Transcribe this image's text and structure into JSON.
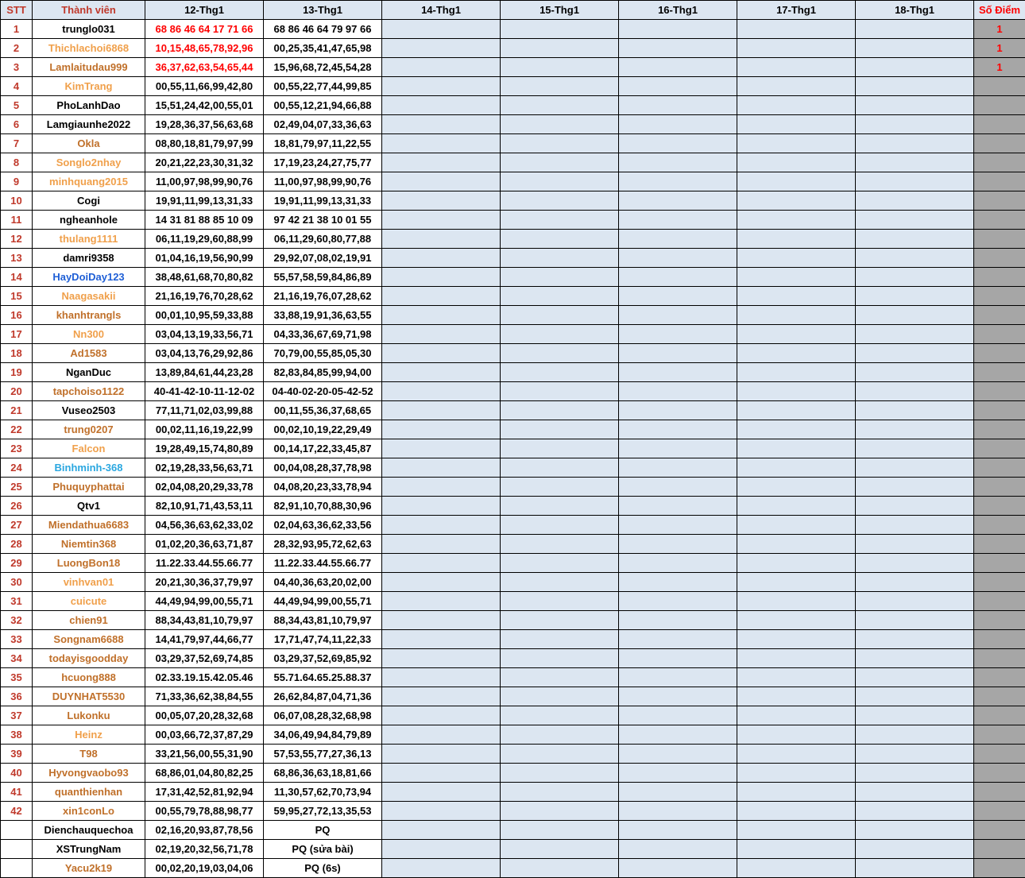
{
  "header": {
    "stt": "STT",
    "member": "Thành viên",
    "days": [
      "12-Thg1",
      "13-Thg1",
      "14-Thg1",
      "15-Thg1",
      "16-Thg1",
      "17-Thg1",
      "18-Thg1"
    ],
    "score": "Số Điểm"
  },
  "colors": {
    "black": "#000000",
    "orange": "#f0a04b",
    "brown": "#c0702a",
    "red": "#ff0000",
    "blue": "#1f5fd6",
    "cyan": "#2aa7e0",
    "header_bg": "#dce6f1",
    "score_bg": "#a6a6a6"
  },
  "rows": [
    {
      "stt": "1",
      "name": "trunglo031",
      "nameColor": "black",
      "d12": "68 86 46 64 17 71 66",
      "d12Red": true,
      "d13": "68 86 46 64 79 97 66",
      "score": "1"
    },
    {
      "stt": "2",
      "name": "Thichlachoi6868",
      "nameColor": "orange",
      "d12": "10,15,48,65,78,92,96",
      "d12Red": true,
      "d13": "00,25,35,41,47,65,98",
      "score": "1"
    },
    {
      "stt": "3",
      "name": "Lamlaitudau999",
      "nameColor": "brown",
      "d12": "36,37,62,63,54,65,44",
      "d12Red": true,
      "d13": "15,96,68,72,45,54,28",
      "score": "1"
    },
    {
      "stt": "4",
      "name": "KimTrang",
      "nameColor": "orange",
      "d12": "00,55,11,66,99,42,80",
      "d13": "00,55,22,77,44,99,85",
      "score": ""
    },
    {
      "stt": "5",
      "name": "PhoLanhDao",
      "nameColor": "black",
      "d12": "15,51,24,42,00,55,01",
      "d13": "00,55,12,21,94,66,88",
      "score": ""
    },
    {
      "stt": "6",
      "name": "Lamgiaunhe2022",
      "nameColor": "black",
      "d12": "19,28,36,37,56,63,68",
      "d13": "02,49,04,07,33,36,63",
      "score": ""
    },
    {
      "stt": "7",
      "name": "Okla",
      "nameColor": "brown",
      "d12": "08,80,18,81,79,97,99",
      "d13": "18,81,79,97,11,22,55",
      "score": ""
    },
    {
      "stt": "8",
      "name": "Songlo2nhay",
      "nameColor": "orange",
      "d12": "20,21,22,23,30,31,32",
      "d13": "17,19,23,24,27,75,77",
      "score": ""
    },
    {
      "stt": "9",
      "name": "minhquang2015",
      "nameColor": "orange",
      "d12": "11,00,97,98,99,90,76",
      "d13": "11,00,97,98,99,90,76",
      "score": ""
    },
    {
      "stt": "10",
      "name": "Cogi",
      "nameColor": "black",
      "d12": "19,91,11,99,13,31,33",
      "d13": "19,91,11,99,13,31,33",
      "score": ""
    },
    {
      "stt": "11",
      "name": "ngheanhole",
      "nameColor": "black",
      "d12": "14 31 81 88 85 10 09",
      "d13": "97 42 21 38 10 01 55",
      "score": ""
    },
    {
      "stt": "12",
      "name": "thulang1111",
      "nameColor": "orange",
      "d12": "06,11,19,29,60,88,99",
      "d13": "06,11,29,60,80,77,88",
      "score": ""
    },
    {
      "stt": "13",
      "name": "damri9358",
      "nameColor": "black",
      "d12": "01,04,16,19,56,90,99",
      "d13": "29,92,07,08,02,19,91",
      "score": ""
    },
    {
      "stt": "14",
      "name": "HayDoiDay123",
      "nameColor": "blue",
      "d12": "38,48,61,68,70,80,82",
      "d13": "55,57,58,59,84,86,89",
      "score": ""
    },
    {
      "stt": "15",
      "name": "Naagasakii",
      "nameColor": "orange",
      "d12": "21,16,19,76,70,28,62",
      "d13": "21,16,19,76,07,28,62",
      "score": ""
    },
    {
      "stt": "16",
      "name": "khanhtrangls",
      "nameColor": "brown",
      "d12": "00,01,10,95,59,33,88",
      "d13": "33,88,19,91,36,63,55",
      "score": ""
    },
    {
      "stt": "17",
      "name": "Nn300",
      "nameColor": "orange",
      "d12": "03,04,13,19,33,56,71",
      "d13": "04,33,36,67,69,71,98",
      "score": ""
    },
    {
      "stt": "18",
      "name": "Ad1583",
      "nameColor": "brown",
      "d12": "03,04,13,76,29,92,86",
      "d13": "70,79,00,55,85,05,30",
      "score": ""
    },
    {
      "stt": "19",
      "name": "NganDuc",
      "nameColor": "black",
      "d12": "13,89,84,61,44,23,28",
      "d13": "82,83,84,85,99,94,00",
      "score": ""
    },
    {
      "stt": "20",
      "name": "tapchoiso1122",
      "nameColor": "brown",
      "d12": "40-41-42-10-11-12-02",
      "d13": "04-40-02-20-05-42-52",
      "score": ""
    },
    {
      "stt": "21",
      "name": "Vuseo2503",
      "nameColor": "black",
      "d12": "77,11,71,02,03,99,88",
      "d13": "00,11,55,36,37,68,65",
      "score": ""
    },
    {
      "stt": "22",
      "name": "trung0207",
      "nameColor": "brown",
      "d12": "00,02,11,16,19,22,99",
      "d13": "00,02,10,19,22,29,49",
      "score": ""
    },
    {
      "stt": "23",
      "name": "Falcon",
      "nameColor": "orange",
      "d12": "19,28,49,15,74,80,89",
      "d13": "00,14,17,22,33,45,87",
      "score": ""
    },
    {
      "stt": "24",
      "name": "Binhminh-368",
      "nameColor": "cyan",
      "d12": "02,19,28,33,56,63,71",
      "d13": "00,04,08,28,37,78,98",
      "score": ""
    },
    {
      "stt": "25",
      "name": "Phuquyphattai",
      "nameColor": "brown",
      "d12": "02,04,08,20,29,33,78",
      "d13": "04,08,20,23,33,78,94",
      "score": ""
    },
    {
      "stt": "26",
      "name": "Qtv1",
      "nameColor": "black",
      "d12": "82,10,91,71,43,53,11",
      "d13": "82,91,10,70,88,30,96",
      "score": ""
    },
    {
      "stt": "27",
      "name": "Miendathua6683",
      "nameColor": "brown",
      "d12": "04,56,36,63,62,33,02",
      "d13": "02,04,63,36,62,33,56",
      "score": ""
    },
    {
      "stt": "28",
      "name": "Niemtin368",
      "nameColor": "brown",
      "d12": "01,02,20,36,63,71,87",
      "d13": "28,32,93,95,72,62,63",
      "score": ""
    },
    {
      "stt": "29",
      "name": "LuongBon18",
      "nameColor": "brown",
      "d12": "11.22.33.44.55.66.77",
      "d13": "11.22.33.44.55.66.77",
      "score": ""
    },
    {
      "stt": "30",
      "name": "vinhvan01",
      "nameColor": "orange",
      "d12": "20,21,30,36,37,79,97",
      "d13": "04,40,36,63,20,02,00",
      "score": ""
    },
    {
      "stt": "31",
      "name": "cuicute",
      "nameColor": "orange",
      "d12": "44,49,94,99,00,55,71",
      "d13": "44,49,94,99,00,55,71",
      "score": ""
    },
    {
      "stt": "32",
      "name": "chien91",
      "nameColor": "brown",
      "d12": "88,34,43,81,10,79,97",
      "d13": "88,34,43,81,10,79,97",
      "score": ""
    },
    {
      "stt": "33",
      "name": "Songnam6688",
      "nameColor": "brown",
      "d12": "14,41,79,97,44,66,77",
      "d13": "17,71,47,74,11,22,33",
      "score": ""
    },
    {
      "stt": "34",
      "name": "todayisgoodday",
      "nameColor": "brown",
      "d12": "03,29,37,52,69,74,85",
      "d13": "03,29,37,52,69,85,92",
      "score": ""
    },
    {
      "stt": "35",
      "name": "hcuong888",
      "nameColor": "brown",
      "d12": "02.33.19.15.42.05.46",
      "d13": "55.71.64.65.25.88.37",
      "score": ""
    },
    {
      "stt": "36",
      "name": "DUYNHAT5530",
      "nameColor": "brown",
      "d12": "71,33,36,62,38,84,55",
      "d13": "26,62,84,87,04,71,36",
      "score": ""
    },
    {
      "stt": "37",
      "name": "Lukonku",
      "nameColor": "brown",
      "d12": "00,05,07,20,28,32,68",
      "d13": "06,07,08,28,32,68,98",
      "score": ""
    },
    {
      "stt": "38",
      "name": "Heinz",
      "nameColor": "orange",
      "d12": "00,03,66,72,37,87,29",
      "d13": "34,06,49,94,84,79,89",
      "score": ""
    },
    {
      "stt": "39",
      "name": "T98",
      "nameColor": "brown",
      "d12": "33,21,56,00,55,31,90",
      "d13": "57,53,55,77,27,36,13",
      "score": ""
    },
    {
      "stt": "40",
      "name": "Hyvongvaobo93",
      "nameColor": "brown",
      "d12": "68,86,01,04,80,82,25",
      "d13": "68,86,36,63,18,81,66",
      "score": ""
    },
    {
      "stt": "41",
      "name": "quanthienhan",
      "nameColor": "brown",
      "d12": "17,31,42,52,81,92,94",
      "d13": "11,30,57,62,70,73,94",
      "score": ""
    },
    {
      "stt": "42",
      "name": "xin1conLo",
      "nameColor": "brown",
      "d12": "00,55,79,78,88,98,77",
      "d13": "59,95,27,72,13,35,53",
      "score": ""
    },
    {
      "stt": "",
      "name": "Dienchauquechoa",
      "nameColor": "black",
      "d12": "02,16,20,93,87,78,56",
      "d13": "PQ",
      "score": ""
    },
    {
      "stt": "",
      "name": "XSTrungNam",
      "nameColor": "black",
      "d12": "02,19,20,32,56,71,78",
      "d13": "PQ (sửa bài)",
      "score": ""
    },
    {
      "stt": "",
      "name": "Yacu2k19",
      "nameColor": "brown",
      "d12": "00,02,20,19,03,04,06",
      "d13": "PQ (6s)",
      "score": ""
    }
  ]
}
